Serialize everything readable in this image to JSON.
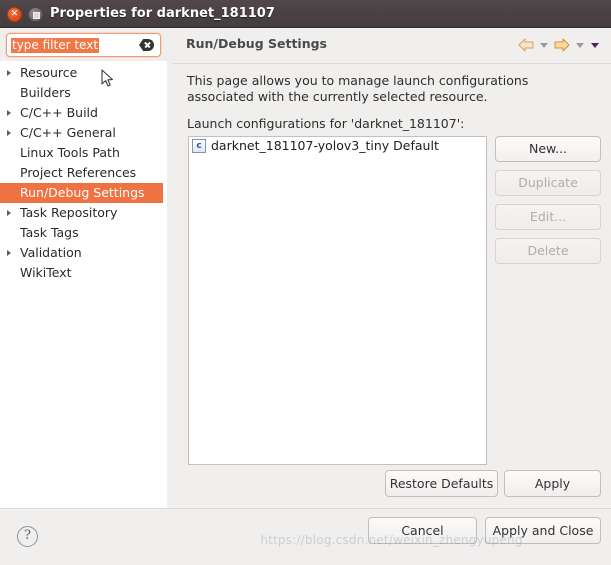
{
  "window": {
    "title": "Properties for darknet_181107",
    "close_icon": "close-icon",
    "maximize_icon": "maximize-icon"
  },
  "sidebar": {
    "filter": {
      "value": "type filter text",
      "placeholder": "type filter text",
      "clear_icon": "clear-backspace-icon"
    },
    "items": [
      {
        "label": "Resource",
        "expandable": true,
        "selected": false
      },
      {
        "label": "Builders",
        "expandable": false,
        "selected": false
      },
      {
        "label": "C/C++ Build",
        "expandable": true,
        "selected": false
      },
      {
        "label": "C/C++ General",
        "expandable": true,
        "selected": false
      },
      {
        "label": "Linux Tools Path",
        "expandable": false,
        "selected": false
      },
      {
        "label": "Project References",
        "expandable": false,
        "selected": false
      },
      {
        "label": "Run/Debug Settings",
        "expandable": false,
        "selected": true
      },
      {
        "label": "Task Repository",
        "expandable": true,
        "selected": false
      },
      {
        "label": "Task Tags",
        "expandable": false,
        "selected": false
      },
      {
        "label": "Validation",
        "expandable": true,
        "selected": false
      },
      {
        "label": "WikiText",
        "expandable": false,
        "selected": false
      }
    ]
  },
  "page": {
    "title": "Run/Debug Settings",
    "description": "This page allows you to manage launch configurations associated with the currently selected resource.",
    "list_label": "Launch configurations for 'darknet_181107':",
    "configurations": [
      {
        "name": "darknet_181107-yolov3_tiny Default",
        "icon": "c-launch-config-icon",
        "icon_letter": "c"
      }
    ],
    "nav": {
      "back_icon": "back-arrow-icon",
      "back_menu_icon": "chevron-down-icon",
      "forward_icon": "forward-arrow-icon",
      "forward_menu_icon": "chevron-down-icon",
      "more_menu_icon": "chevron-down-icon"
    },
    "side_buttons": [
      {
        "label": "New...",
        "enabled": true
      },
      {
        "label": "Duplicate",
        "enabled": false
      },
      {
        "label": "Edit...",
        "enabled": false
      },
      {
        "label": "Delete",
        "enabled": false
      }
    ],
    "restore_defaults_label": "Restore Defaults",
    "apply_label": "Apply"
  },
  "footer": {
    "help_icon": "help-question-icon",
    "help_glyph": "?",
    "cancel_label": "Cancel",
    "apply_and_close_label": "Apply and Close"
  },
  "watermark": "https://blog.csdn.net/weixin_zhengyupeng",
  "colors": {
    "accent_orange": "#ef7243",
    "titlebar": "#494143",
    "window_bg": "#f0efee",
    "list_bg": "#ffffff",
    "border": "#c3c0bd"
  }
}
